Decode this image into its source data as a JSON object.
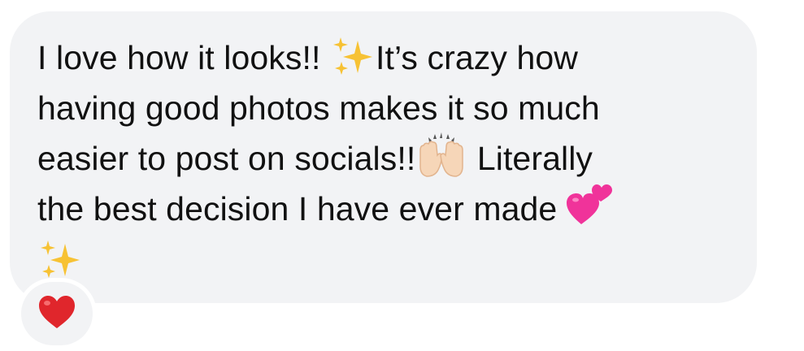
{
  "message": {
    "lines": [
      {
        "before": "I love how it looks!! ",
        "after": "It’s crazy how"
      },
      {
        "text": "having good photos makes it so much"
      },
      {
        "before": "easier to post on socials!!",
        "after": " Literally"
      },
      {
        "before": "the best decision I have ever made "
      }
    ]
  },
  "emoji": {
    "sparkles": "sparkles-icon",
    "raised_hands": "raising-hands-icon",
    "two_hearts": "two-hearts-icon"
  },
  "reaction": {
    "icon": "red-heart-icon",
    "color": "#e0262c"
  },
  "colors": {
    "bubble": "#f2f3f5",
    "text": "#111111",
    "sparkle": "#f7c234",
    "heart_pink": "#f0339a"
  }
}
